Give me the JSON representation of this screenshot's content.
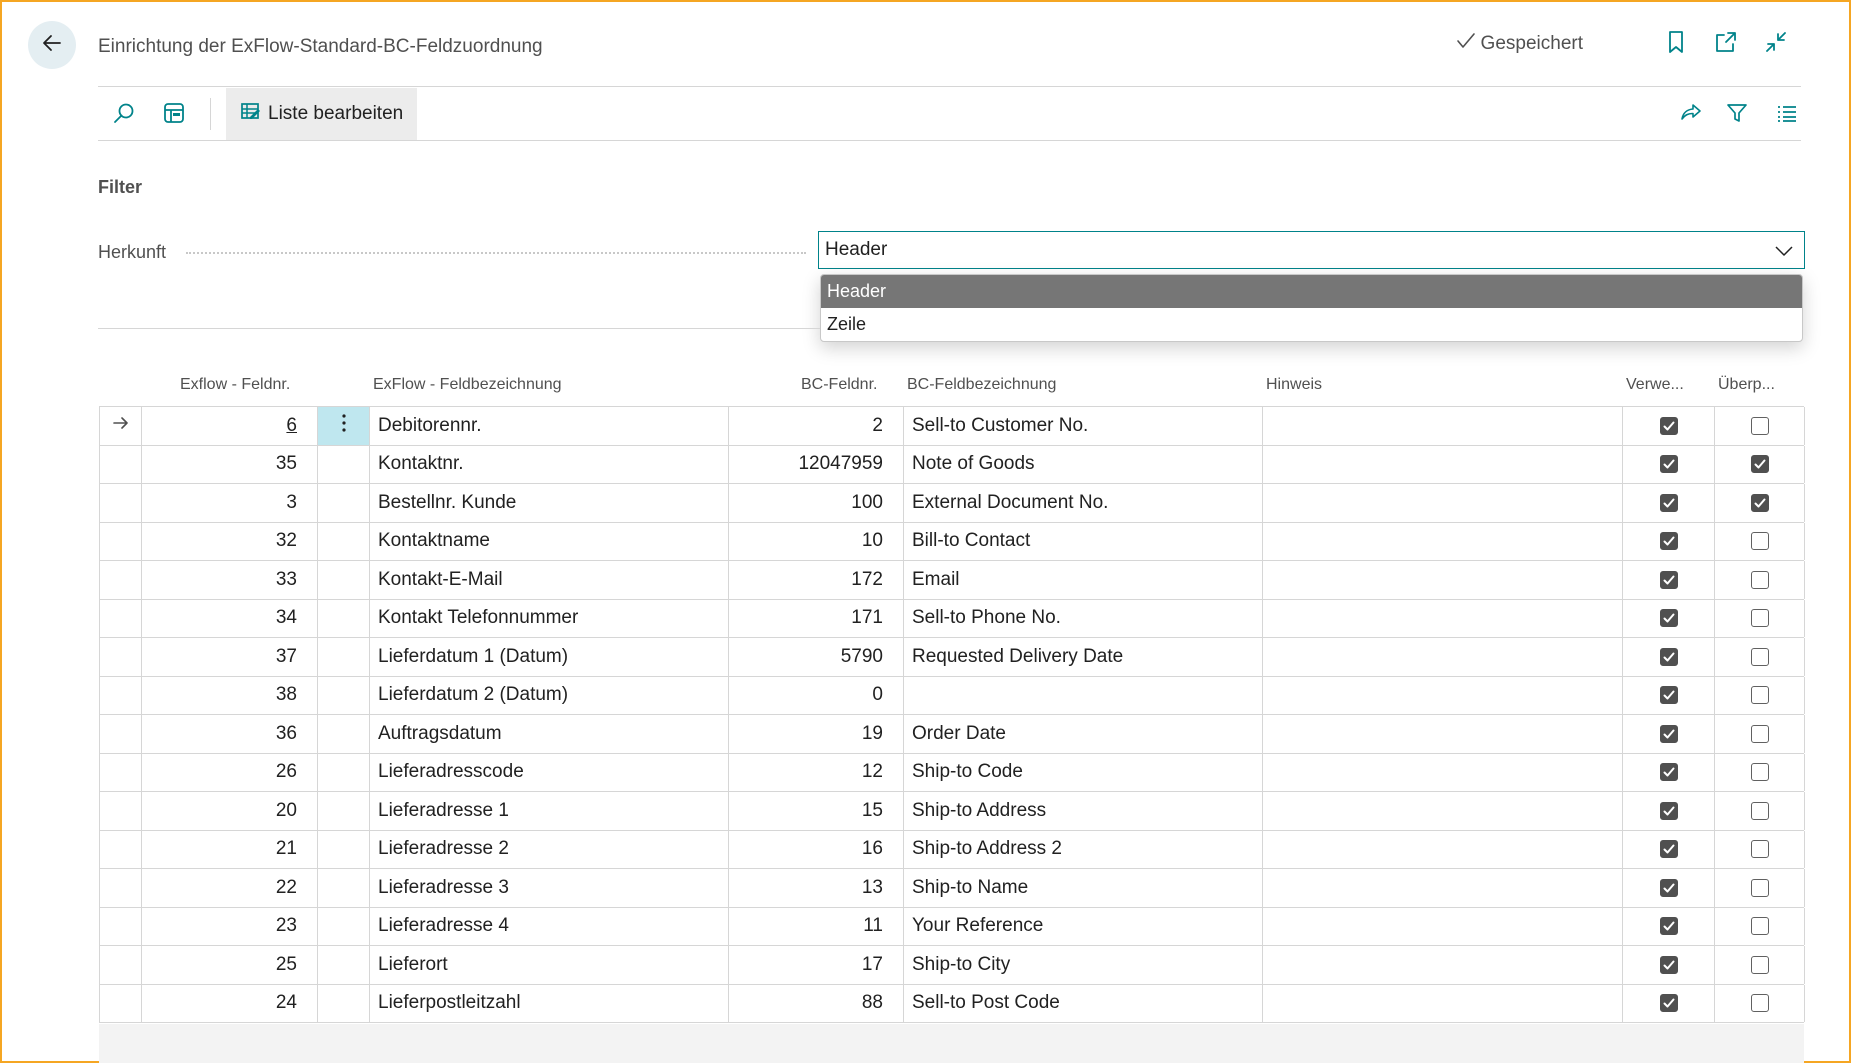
{
  "header": {
    "title": "Einrichtung der ExFlow-Standard-BC-Feldzuordnung",
    "saved_label": "Gespeichert"
  },
  "toolbar": {
    "edit_list_label": "Liste bearbeiten"
  },
  "filter": {
    "heading": "Filter",
    "field_label": "Herkunft",
    "selected_value": "Header",
    "options": [
      "Header",
      "Zeile"
    ]
  },
  "table": {
    "columns": {
      "exflow_fieldno": "Exflow - Feldnr.",
      "exflow_fielddesc": "ExFlow - Feldbezeichnung",
      "bc_fieldno": "BC-Feldnr.",
      "bc_fielddesc": "BC-Feldbezeichnung",
      "note": "Hinweis",
      "use": "Verwe...",
      "check": "Überp..."
    },
    "rows": [
      {
        "fno": "6",
        "fdesc": "Debitorennr.",
        "bcno": "2",
        "bcdesc": "Sell-to Customer No.",
        "note": "",
        "use": true,
        "check": false
      },
      {
        "fno": "35",
        "fdesc": "Kontaktnr.",
        "bcno": "12047959",
        "bcdesc": "Note of Goods",
        "note": "",
        "use": true,
        "check": true
      },
      {
        "fno": "3",
        "fdesc": "Bestellnr. Kunde",
        "bcno": "100",
        "bcdesc": "External Document No.",
        "note": "",
        "use": true,
        "check": true
      },
      {
        "fno": "32",
        "fdesc": "Kontaktname",
        "bcno": "10",
        "bcdesc": "Bill-to Contact",
        "note": "",
        "use": true,
        "check": false
      },
      {
        "fno": "33",
        "fdesc": "Kontakt-E-Mail",
        "bcno": "172",
        "bcdesc": "Email",
        "note": "",
        "use": true,
        "check": false
      },
      {
        "fno": "34",
        "fdesc": "Kontakt Telefonnummer",
        "bcno": "171",
        "bcdesc": "Sell-to Phone No.",
        "note": "",
        "use": true,
        "check": false
      },
      {
        "fno": "37",
        "fdesc": "Lieferdatum 1 (Datum)",
        "bcno": "5790",
        "bcdesc": "Requested Delivery Date",
        "note": "",
        "use": true,
        "check": false
      },
      {
        "fno": "38",
        "fdesc": "Lieferdatum 2 (Datum)",
        "bcno": "0",
        "bcdesc": "",
        "note": "",
        "use": true,
        "check": false
      },
      {
        "fno": "36",
        "fdesc": "Auftragsdatum",
        "bcno": "19",
        "bcdesc": "Order Date",
        "note": "",
        "use": true,
        "check": false
      },
      {
        "fno": "26",
        "fdesc": "Lieferadresscode",
        "bcno": "12",
        "bcdesc": "Ship-to Code",
        "note": "",
        "use": true,
        "check": false
      },
      {
        "fno": "20",
        "fdesc": "Lieferadresse 1",
        "bcno": "15",
        "bcdesc": "Ship-to Address",
        "note": "",
        "use": true,
        "check": false
      },
      {
        "fno": "21",
        "fdesc": "Lieferadresse 2",
        "bcno": "16",
        "bcdesc": "Ship-to Address 2",
        "note": "",
        "use": true,
        "check": false
      },
      {
        "fno": "22",
        "fdesc": "Lieferadresse 3",
        "bcno": "13",
        "bcdesc": "Ship-to Name",
        "note": "",
        "use": true,
        "check": false
      },
      {
        "fno": "23",
        "fdesc": "Lieferadresse 4",
        "bcno": "11",
        "bcdesc": "Your Reference",
        "note": "",
        "use": true,
        "check": false
      },
      {
        "fno": "25",
        "fdesc": "Lieferort",
        "bcno": "17",
        "bcdesc": "Ship-to City",
        "note": "",
        "use": true,
        "check": false
      },
      {
        "fno": "24",
        "fdesc": "Lieferpostleitzahl",
        "bcno": "88",
        "bcdesc": "Sell-to Post Code",
        "note": "",
        "use": true,
        "check": false
      }
    ]
  },
  "colors": {
    "accent": "#00838a",
    "frame": "#f5a623",
    "selected_option_bg": "#767676",
    "active_cell_bg": "#bfe7ef"
  },
  "icons": {
    "back": "back-arrow-icon",
    "saved": "checkmark-icon",
    "bookmark": "bookmark-icon",
    "open_new": "open-in-new-window-icon",
    "collapse": "collapse-icon",
    "search": "search-icon",
    "layout": "layout-icon",
    "edit_list": "edit-list-icon",
    "share": "share-icon",
    "filter": "filter-icon",
    "list_view": "list-view-icon",
    "row_pointer": "row-arrow-icon",
    "row_menu": "more-vertical-icon",
    "dropdown": "chevron-down-icon"
  }
}
